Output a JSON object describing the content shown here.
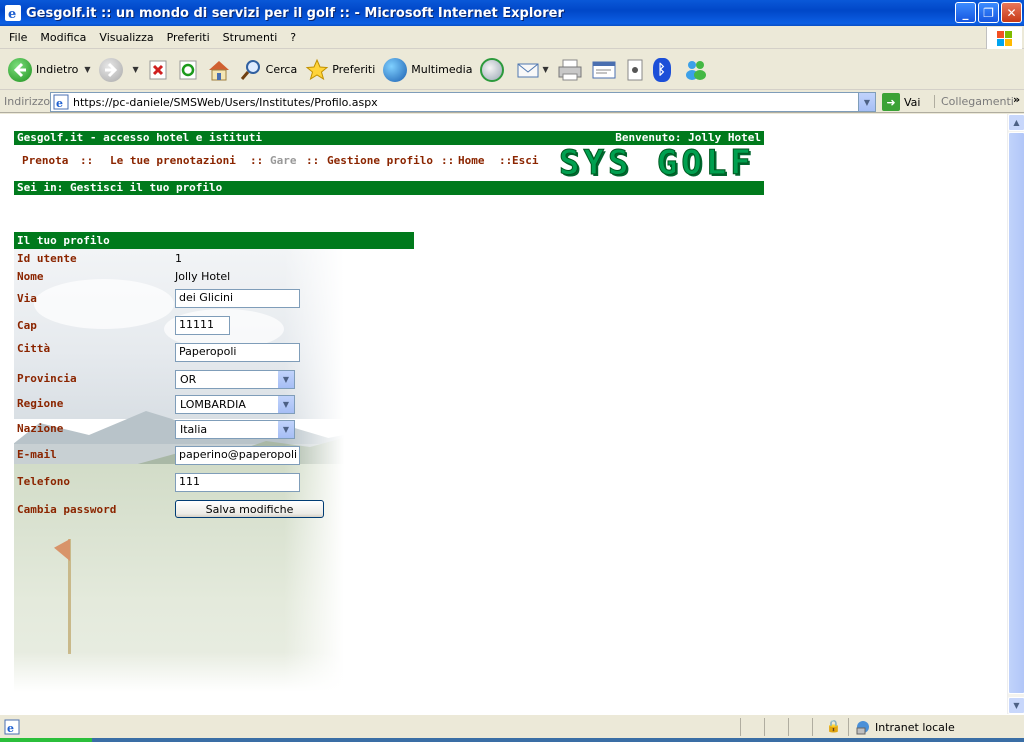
{
  "window": {
    "title": "Gesgolf.it :: un mondo di servizi per il golf :: - Microsoft Internet Explorer",
    "minimize": "_",
    "maximize": "❐",
    "close": "✕"
  },
  "menu": {
    "items": [
      "File",
      "Modifica",
      "Visualizza",
      "Preferiti",
      "Strumenti",
      "?"
    ]
  },
  "toolbar": {
    "back_label": "Indietro",
    "search_label": "Cerca",
    "favorites_label": "Preferiti",
    "media_label": "Multimedia"
  },
  "address": {
    "label": "Indirizzo",
    "url": "https://pc-daniele/SMSWeb/Users/Institutes/Profilo.aspx",
    "go_label": "Vai",
    "links_label": "Collegamenti"
  },
  "site": {
    "header_left": "Gesgolf.it - accesso hotel e istituti",
    "header_right": "Benvenuto: Jolly Hotel",
    "logo": "SYS GOLF",
    "nav": {
      "prenota": "Prenota",
      "prenotazioni": "Le tue prenotazioni",
      "gare": "Gare",
      "gestione": "Gestione profilo",
      "home": "Home",
      "esci": "Esci",
      "sep": "::"
    },
    "breadcrumb": "Sei in: Gestisci il tuo profilo"
  },
  "profile": {
    "header": "Il tuo profilo",
    "labels": {
      "id": "Id utente",
      "nome": "Nome",
      "via": "Via",
      "cap": "Cap",
      "citta": "Città",
      "provincia": "Provincia",
      "regione": "Regione",
      "nazione": "Nazione",
      "email": "E-mail",
      "telefono": "Telefono",
      "password": "Cambia password"
    },
    "values": {
      "id": "1",
      "nome": "Jolly Hotel",
      "via": "dei Glicini",
      "cap": "11111",
      "citta": "Paperopoli",
      "provincia": "OR",
      "regione": "LOMBARDIA",
      "nazione": "Italia",
      "email": "paperino@paperopoli",
      "telefono": "111"
    },
    "save_label": "Salva modifiche"
  },
  "status": {
    "zone": "Intranet locale"
  },
  "colors": {
    "site_green": "#007A1C",
    "label_brown": "#8B2500",
    "logo_green": "#00A050"
  }
}
